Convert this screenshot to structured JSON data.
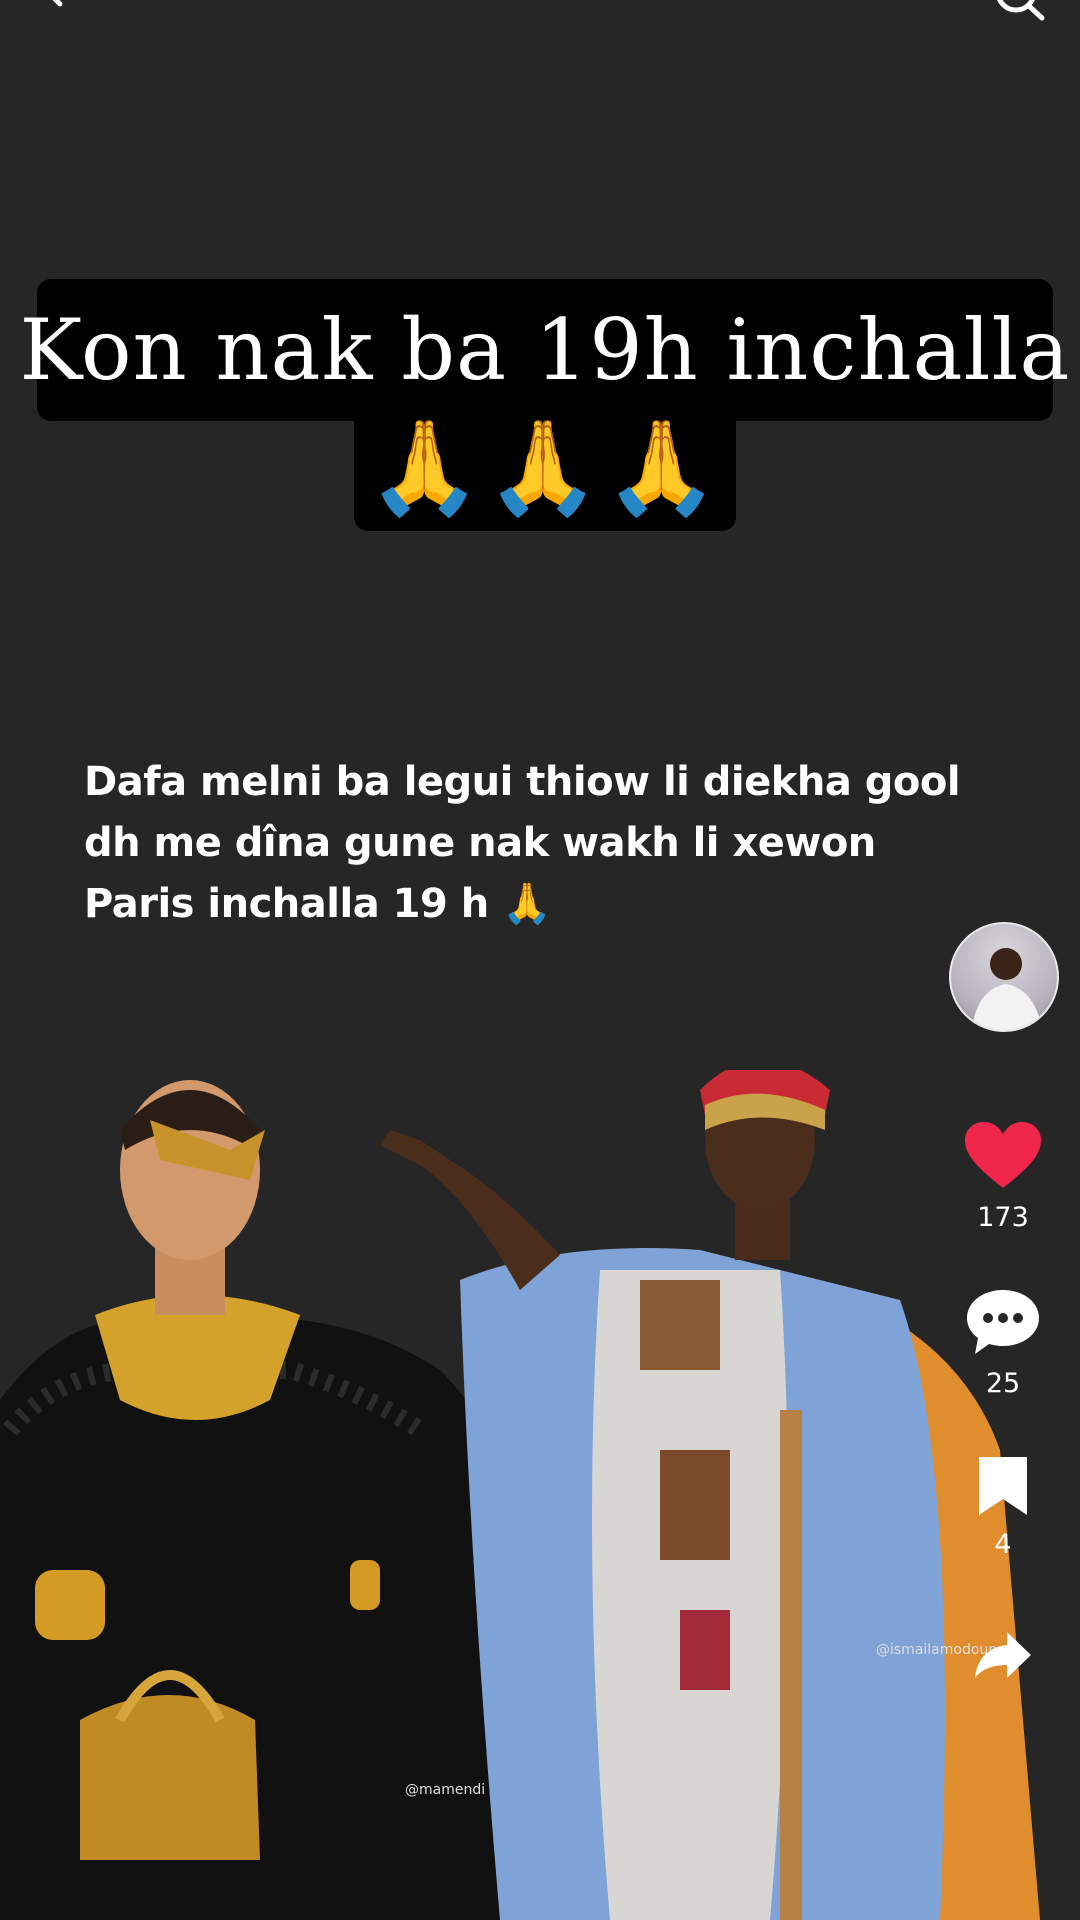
{
  "caption": {
    "line1": "Kon nak ba 19h inchalla",
    "line2": "🙏🙏🙏"
  },
  "description": {
    "line1": "Dafa melni ba legui thiow li diekha gool",
    "line2": "dh me dîna gune nak wakh li xewon",
    "line3": "Paris inchalla 19 h 🙏"
  },
  "actions": {
    "likes": "173",
    "comments": "25",
    "saves": "4"
  },
  "watermarks": {
    "left": "@mamendi",
    "right": "@ismailamodoun"
  },
  "colors": {
    "background": "#262626",
    "like": "#f0264b",
    "caption_bg": "#000000"
  },
  "icons": [
    "back-icon",
    "search-icon",
    "heart-icon",
    "comment-icon",
    "bookmark-icon",
    "share-icon"
  ]
}
